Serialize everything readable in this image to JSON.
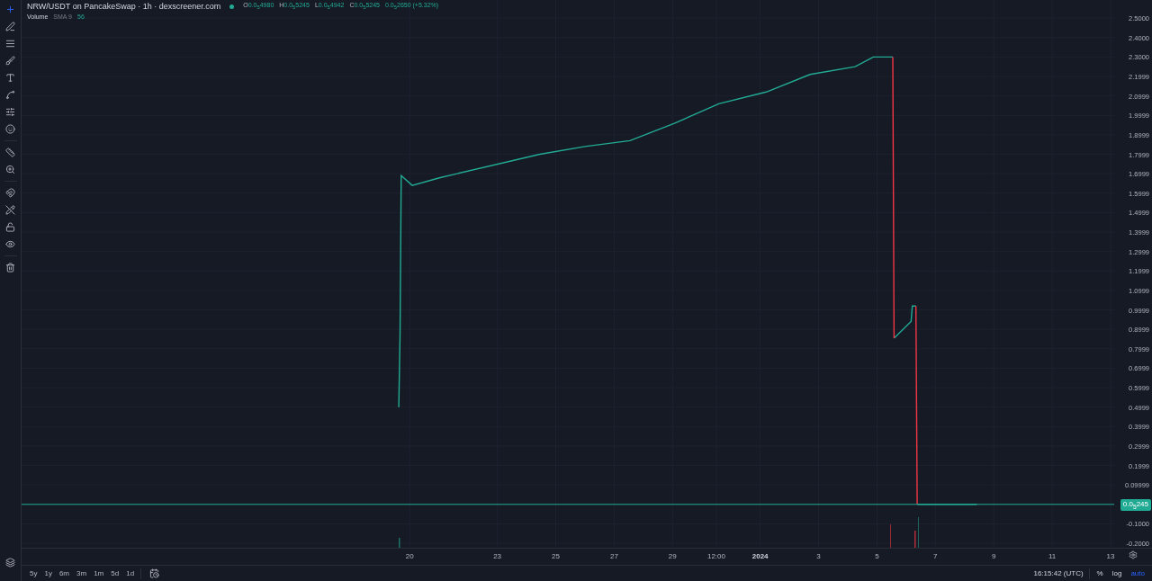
{
  "header": {
    "title": "NRW/USDT on PancakeSwap · 1h · dexscreener.com",
    "ohlc": [
      {
        "label": "O",
        "value": "0.0$_{5}$4980"
      },
      {
        "label": "H",
        "value": "0.0$_{5}$5245"
      },
      {
        "label": "L",
        "value": "0.0$_{5}$4942"
      },
      {
        "label": "C",
        "value": "0.0$_{5}$5245"
      }
    ],
    "change": "0.0$_{5}$2650 (+5.32%)",
    "volume": {
      "label": "Volume",
      "indicator": "SMA 9",
      "value": "56"
    }
  },
  "chart": {
    "price_tag": "0.0$_{5}$245",
    "chart_data": {
      "type": "line",
      "grid": true,
      "xlim": [
        "2023-12-06T17:00",
        "2024-01-14T10:00"
      ],
      "ylim": [
        -0.394,
        2.593
      ],
      "xticks": [
        {
          "value": "2023-12-20T00:00",
          "label": "20"
        },
        {
          "value": "2023-12-23T00:00",
          "label": "23"
        },
        {
          "value": "2023-12-25T00:00",
          "label": "25"
        },
        {
          "value": "2023-12-27T00:00",
          "label": "27"
        },
        {
          "value": "2023-12-29T00:00",
          "label": "29"
        },
        {
          "value": "2023-12-30T12:00",
          "label": "12:00"
        },
        {
          "value": "2024-01-01T00:00",
          "label": "2024"
        },
        {
          "value": "2024-01-03T00:00",
          "label": "3"
        },
        {
          "value": "2024-01-05T00:00",
          "label": "5"
        },
        {
          "value": "2024-01-07T00:00",
          "label": "7"
        },
        {
          "value": "2024-01-09T00:00",
          "label": "9"
        },
        {
          "value": "2024-01-11T00:00",
          "label": "11"
        },
        {
          "value": "2024-01-13T00:00",
          "label": "13"
        }
      ],
      "yticks": [
        {
          "value": 2.5,
          "label": "2.5000"
        },
        {
          "value": 2.4,
          "label": "2.4000"
        },
        {
          "value": 2.3,
          "label": "2.3000"
        },
        {
          "value": 2.1999,
          "label": "2.1999"
        },
        {
          "value": 2.0999,
          "label": "2.0999"
        },
        {
          "value": 1.9999,
          "label": "1.9999"
        },
        {
          "value": 1.8999,
          "label": "1.8999"
        },
        {
          "value": 1.7999,
          "label": "1.7999"
        },
        {
          "value": 1.6999,
          "label": "1.6999"
        },
        {
          "value": 1.5999,
          "label": "1.5999"
        },
        {
          "value": 1.4999,
          "label": "1.4999"
        },
        {
          "value": 1.3999,
          "label": "1.3999"
        },
        {
          "value": 1.2999,
          "label": "1.2999"
        },
        {
          "value": 1.1999,
          "label": "1.1999"
        },
        {
          "value": 1.0999,
          "label": "1.0999"
        },
        {
          "value": 0.9999,
          "label": "0.9999"
        },
        {
          "value": 0.8999,
          "label": "0.8999"
        },
        {
          "value": 0.7999,
          "label": "0.7999"
        },
        {
          "value": 0.6999,
          "label": "0.6999"
        },
        {
          "value": 0.5999,
          "label": "0.5999"
        },
        {
          "value": 0.4999,
          "label": "0.4999"
        },
        {
          "value": 0.3999,
          "label": "0.3999"
        },
        {
          "value": 0.2999,
          "label": "0.2999"
        },
        {
          "value": 0.1999,
          "label": "0.1999"
        },
        {
          "value": 0.09999,
          "label": "0.09999"
        },
        {
          "value": -0.1,
          "label": "-0.1000"
        },
        {
          "value": -0.2,
          "label": "-0.2000"
        }
      ],
      "x": [
        "2023-12-19T15:00",
        "2023-12-19T16:00",
        "2023-12-19T17:00",
        "2023-12-20T02:00",
        "2023-12-21T01:00",
        "2023-12-24T11:00",
        "2023-12-26T00:00",
        "2023-12-27T13:00",
        "2023-12-29T02:00",
        "2023-12-30T14:00",
        "2024-01-01T05:00",
        "2024-01-02T17:00",
        "2024-01-04T06:00",
        "2024-01-04T21:00",
        "2024-01-05T13:00",
        "2024-01-05T13:30",
        "2024-01-05T14:00",
        "2024-01-06T04:00",
        "2024-01-06T05:00",
        "2024-01-06T08:00",
        "2024-01-06T08:30",
        "2024-01-06T09:00",
        "2024-01-08T10:00"
      ],
      "series": [
        {
          "color": "#22ab94",
          "values": [
            0.5,
            0.87,
            1.69,
            1.64,
            1.68,
            1.8,
            1.84,
            1.87,
            1.96,
            2.06,
            2.12,
            2.21,
            2.25,
            2.3,
            2.3,
            null,
            0.855,
            0.94,
            1.02,
            1.02,
            null,
            0.0,
            0.0
          ]
        },
        {
          "color": "#f23645",
          "values": [
            null,
            null,
            null,
            null,
            null,
            null,
            null,
            null,
            null,
            null,
            null,
            null,
            null,
            null,
            2.3,
            1.58,
            0.855,
            null,
            null,
            1.02,
            0.51,
            0.0,
            null
          ]
        }
      ],
      "ref_lines": [
        {
          "axis": "y",
          "value": 2.45e-06,
          "color": "#22ab94"
        }
      ]
    }
  },
  "bottom_bar": {
    "ranges": [
      "5y",
      "1y",
      "6m",
      "3m",
      "1m",
      "5d",
      "1d"
    ],
    "time": "16:15:42 (UTC)",
    "scale_options": [
      {
        "label": "%",
        "selected": false
      },
      {
        "label": "log",
        "selected": false
      },
      {
        "label": "auto",
        "selected": true
      }
    ]
  }
}
